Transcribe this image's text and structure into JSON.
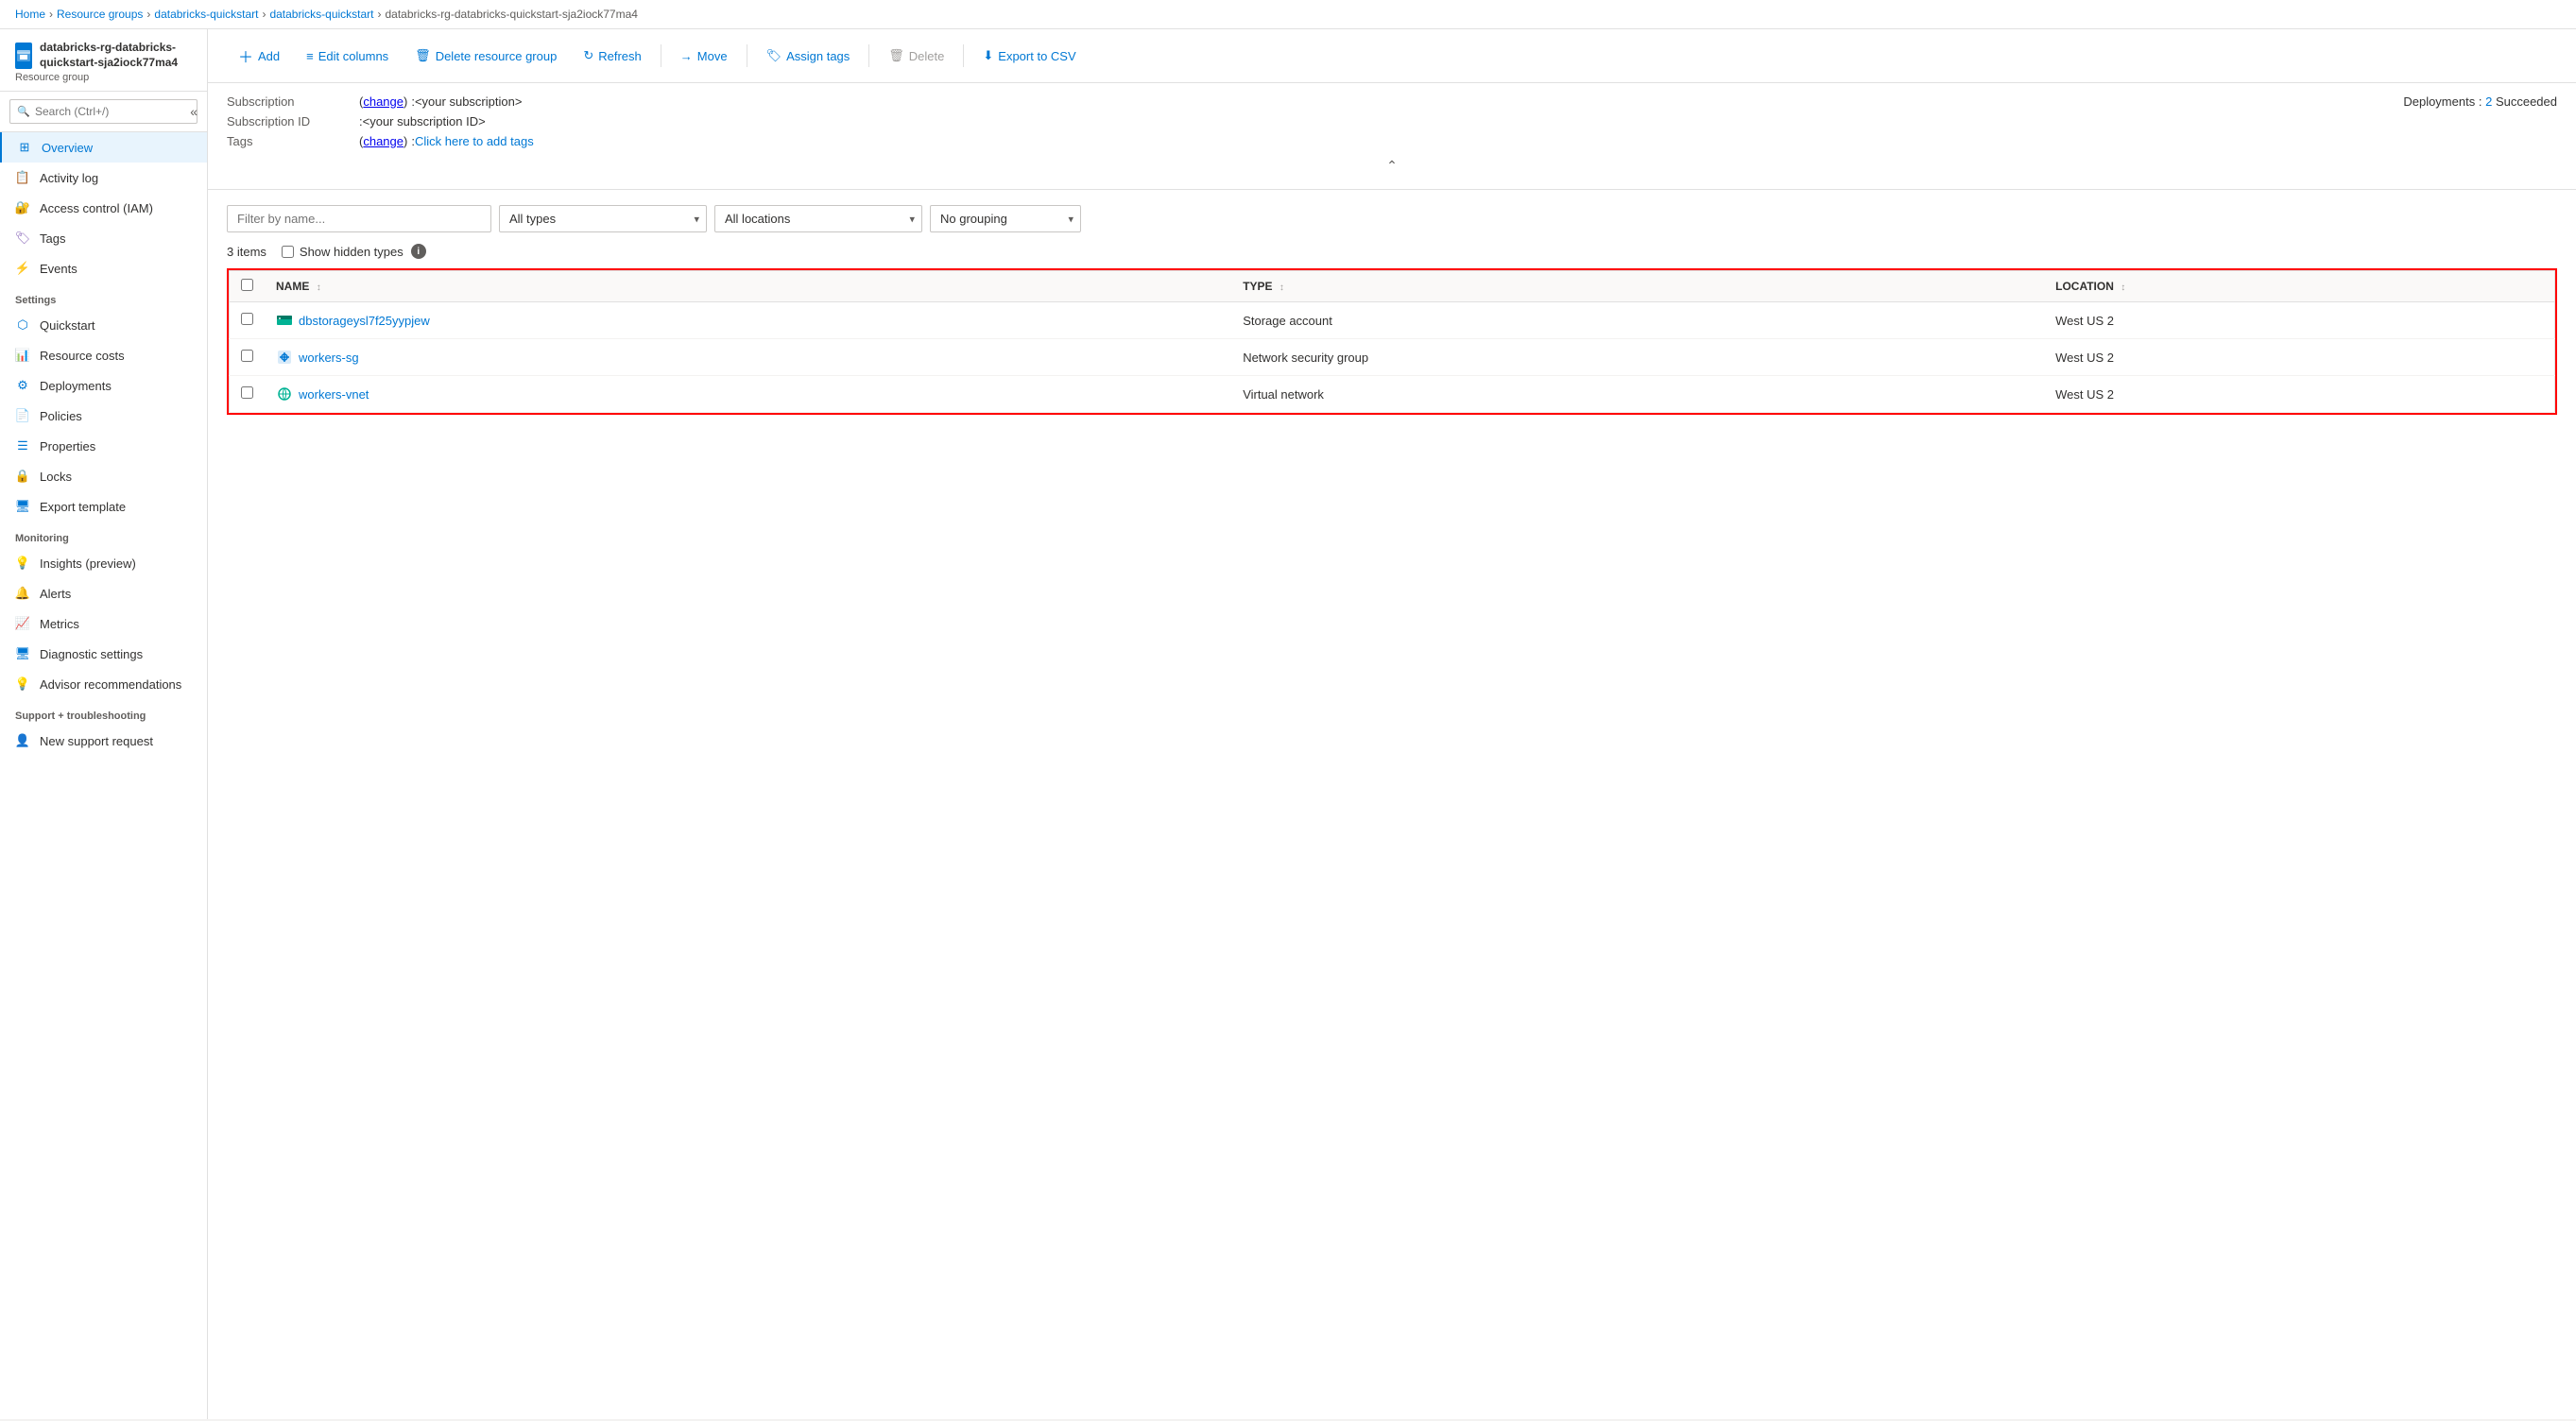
{
  "breadcrumb": {
    "items": [
      "Home",
      "Resource groups",
      "databricks-quickstart",
      "databricks-quickstart",
      "databricks-rg-databricks-quickstart-sja2iock77ma4"
    ]
  },
  "sidebar": {
    "resource_group_name": "databricks-rg-databricks-quickstart-sja2iock77ma4",
    "resource_group_subtitle": "Resource group",
    "search_placeholder": "Search (Ctrl+/)",
    "nav_items": [
      {
        "id": "overview",
        "label": "Overview",
        "section": "main",
        "active": true
      },
      {
        "id": "activity-log",
        "label": "Activity log",
        "section": "main"
      },
      {
        "id": "access-control",
        "label": "Access control (IAM)",
        "section": "main"
      },
      {
        "id": "tags",
        "label": "Tags",
        "section": "main"
      },
      {
        "id": "events",
        "label": "Events",
        "section": "main"
      }
    ],
    "settings_section": "Settings",
    "settings_items": [
      {
        "id": "quickstart",
        "label": "Quickstart"
      },
      {
        "id": "resource-costs",
        "label": "Resource costs"
      },
      {
        "id": "deployments",
        "label": "Deployments"
      },
      {
        "id": "policies",
        "label": "Policies"
      },
      {
        "id": "properties",
        "label": "Properties"
      },
      {
        "id": "locks",
        "label": "Locks"
      },
      {
        "id": "export-template",
        "label": "Export template"
      }
    ],
    "monitoring_section": "Monitoring",
    "monitoring_items": [
      {
        "id": "insights",
        "label": "Insights (preview)"
      },
      {
        "id": "alerts",
        "label": "Alerts"
      },
      {
        "id": "metrics",
        "label": "Metrics"
      },
      {
        "id": "diagnostic-settings",
        "label": "Diagnostic settings"
      },
      {
        "id": "advisor-recommendations",
        "label": "Advisor recommendations"
      }
    ],
    "support_section": "Support + troubleshooting",
    "support_items": [
      {
        "id": "new-support-request",
        "label": "New support request"
      }
    ]
  },
  "toolbar": {
    "add_label": "Add",
    "edit_columns_label": "Edit columns",
    "delete_rg_label": "Delete resource group",
    "refresh_label": "Refresh",
    "move_label": "Move",
    "assign_tags_label": "Assign tags",
    "delete_label": "Delete",
    "export_csv_label": "Export to CSV"
  },
  "info": {
    "subscription_label": "Subscription",
    "subscription_change_link": "change",
    "subscription_value": "<your subscription>",
    "subscription_id_label": "Subscription ID",
    "subscription_id_value": "<your subscription ID>",
    "tags_label": "Tags",
    "tags_change_link": "change",
    "tags_add_link": "Click here to add tags",
    "deployments_label": "Deployments",
    "deployments_count": "2",
    "deployments_status": "Succeeded"
  },
  "resources": {
    "filter_placeholder": "Filter by name...",
    "types_label": "All types",
    "locations_label": "All locations",
    "grouping_label": "No grouping",
    "items_count": "3 items",
    "show_hidden_label": "Show hidden types",
    "columns": [
      {
        "id": "name",
        "label": "NAME"
      },
      {
        "id": "type",
        "label": "TYPE"
      },
      {
        "id": "location",
        "label": "LOCATION"
      }
    ],
    "rows": [
      {
        "name": "dbstorageysl7f25yypjew",
        "type": "Storage account",
        "location": "West US 2",
        "icon_type": "storage"
      },
      {
        "name": "workers-sg",
        "type": "Network security group",
        "location": "West US 2",
        "icon_type": "network-sg"
      },
      {
        "name": "workers-vnet",
        "type": "Virtual network",
        "location": "West US 2",
        "icon_type": "vnet"
      }
    ]
  }
}
